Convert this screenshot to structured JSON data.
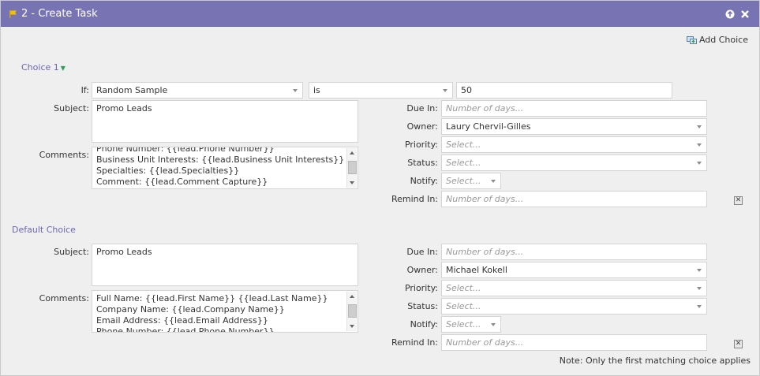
{
  "dialog": {
    "title": "2 - Create Task",
    "add_choice_label": "Add Choice",
    "note": "Note: Only the first matching choice applies",
    "help_icon": "help-icon",
    "close_icon": "close-icon"
  },
  "choice1": {
    "label": "Choice 1",
    "if_label": "If:",
    "condition_field": "Random Sample",
    "operator": "is",
    "value": "50",
    "subject_label": "Subject:",
    "subject": "Promo Leads",
    "comments_label": "Comments:",
    "comments_lines": [
      "Phone Number: {{lead.Phone Number}}",
      "Business Unit Interests: {{lead.Business Unit Interests}}",
      "Specialties: {{lead.Specialties}}",
      "Comment: {{lead.Comment Capture}}"
    ],
    "due_in_label": "Due In:",
    "due_in_placeholder": "Number of days...",
    "owner_label": "Owner:",
    "owner": "Laury Chervil-Gilles",
    "priority_label": "Priority:",
    "priority_placeholder": "Select...",
    "status_label": "Status:",
    "status_placeholder": "Select...",
    "notify_label": "Notify:",
    "notify_placeholder": "Select...",
    "remind_in_label": "Remind In:",
    "remind_in_placeholder": "Number of days..."
  },
  "default_choice": {
    "label": "Default Choice",
    "subject_label": "Subject:",
    "subject": "Promo Leads",
    "comments_label": "Comments:",
    "comments_lines": [
      "Full Name: {{lead.First Name}} {{lead.Last Name}}",
      "Company Name: {{lead.Company Name}}",
      "Email Address: {{lead.Email Address}}",
      "Phone Number: {{lead.Phone Number}}"
    ],
    "due_in_label": "Due In:",
    "due_in_placeholder": "Number of days...",
    "owner_label": "Owner:",
    "owner": "Michael Kokell",
    "priority_label": "Priority:",
    "priority_placeholder": "Select...",
    "status_label": "Status:",
    "status_placeholder": "Select...",
    "notify_label": "Notify:",
    "notify_placeholder": "Select...",
    "remind_in_label": "Remind In:",
    "remind_in_placeholder": "Number of days..."
  },
  "colors": {
    "titlebar": "#7873b2",
    "link": "#6a66b5",
    "panel": "#efefef"
  }
}
